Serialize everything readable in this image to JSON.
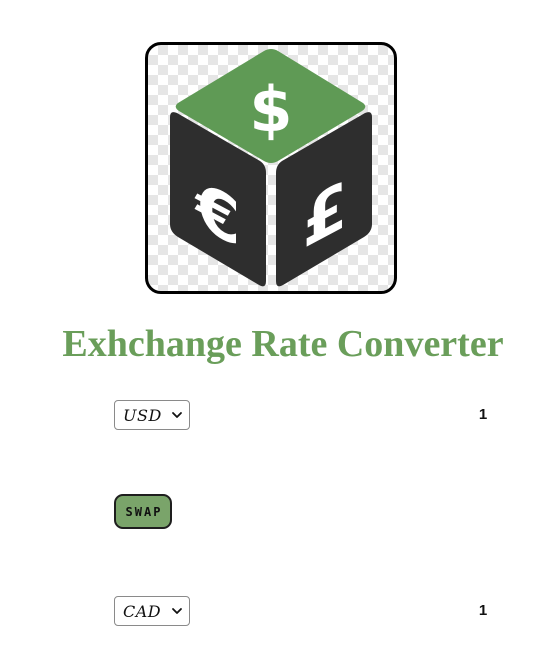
{
  "app": {
    "title": "Exhchange Rate Converter"
  },
  "logo": {
    "icon": "currency-cube-logo",
    "top_color": "#5f9a55",
    "side_color": "#2e2e2e",
    "symbols": [
      "$",
      "€",
      "£"
    ]
  },
  "from": {
    "selected": "USD",
    "amount": "1"
  },
  "to": {
    "selected": "CAD",
    "amount": "1"
  },
  "swap": {
    "label": "SWAP",
    "color": "#7aa46a"
  },
  "colors": {
    "title": "#6a9e5a"
  }
}
